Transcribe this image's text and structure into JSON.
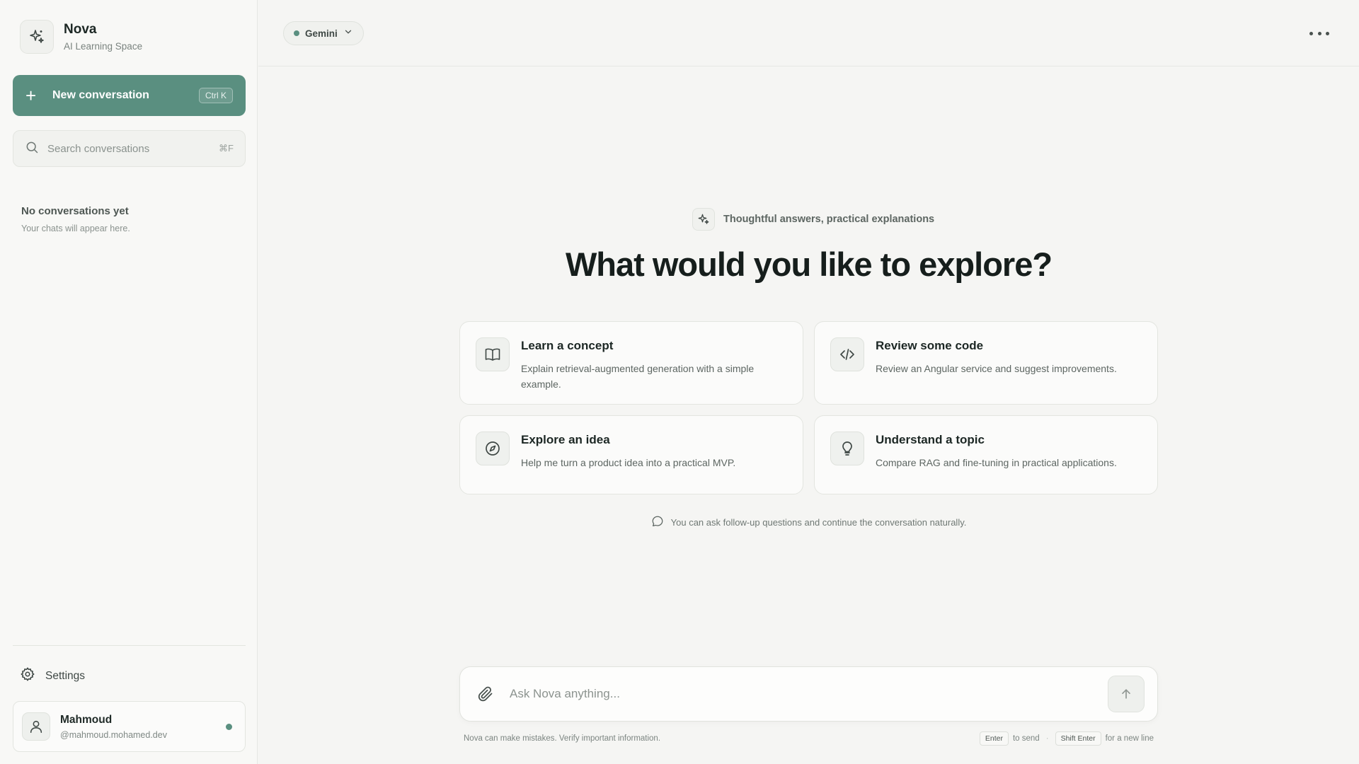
{
  "brand": {
    "name": "Nova",
    "subtitle": "AI Learning Space"
  },
  "sidebar": {
    "new_conversation_label": "New conversation",
    "new_conversation_shortcut": "Ctrl K",
    "search_placeholder": "Search conversations",
    "search_shortcut": "⌘F",
    "empty_title": "No conversations yet",
    "empty_subtitle": "Your chats will appear here.",
    "settings_label": "Settings",
    "user": {
      "name": "Mahmoud",
      "handle": "@mahmoud.mohamed.dev",
      "status": "online"
    }
  },
  "topbar": {
    "model_label": "Gemini",
    "more_icon": "more-horizontal-icon"
  },
  "hero": {
    "tagline": "Thoughtful answers, practical explanations",
    "headline": "What would you like to explore?"
  },
  "suggestions": [
    {
      "icon": "book-open-icon",
      "title": "Learn a concept",
      "description": "Explain retrieval-augmented generation with a simple example."
    },
    {
      "icon": "code-icon",
      "title": "Review some code",
      "description": "Review an Angular service and suggest improvements."
    },
    {
      "icon": "compass-icon",
      "title": "Explore an idea",
      "description": "Help me turn a product idea into a practical MVP."
    },
    {
      "icon": "lightbulb-icon",
      "title": "Understand a topic",
      "description": "Compare RAG and fine-tuning in practical applications."
    }
  ],
  "hint": "You can ask follow-up questions and continue the conversation naturally.",
  "composer": {
    "placeholder": "Ask Nova anything...",
    "disclaimer": "Nova can make mistakes. Verify important information.",
    "send_key": "Enter",
    "send_text": "to send",
    "newline_key": "Shift Enter",
    "newline_text": "for a new line"
  },
  "colors": {
    "accent": "#5a8f80",
    "background": "#f5f5f3",
    "sidebar": "#f8f8f6"
  }
}
